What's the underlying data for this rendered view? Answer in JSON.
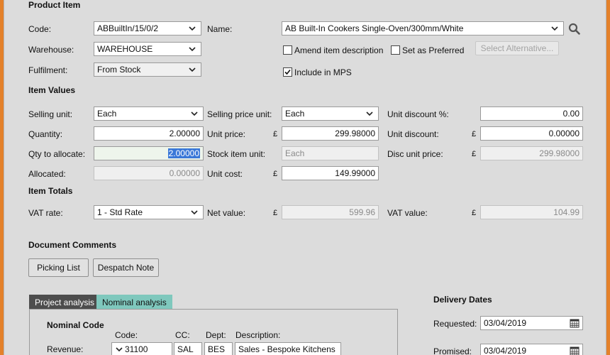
{
  "sections": {
    "product_item": "Product Item",
    "item_values": "Item Values",
    "item_totals": "Item Totals",
    "document_comments": "Document Comments",
    "delivery_dates": "Delivery Dates"
  },
  "product": {
    "code_label": "Code:",
    "code_value": "ABBuiltIn/15/0/2",
    "name_label": "Name:",
    "name_value": "AB Built-In Cookers Single-Oven/300mm/White",
    "warehouse_label": "Warehouse:",
    "warehouse_value": "WAREHOUSE",
    "fulfilment_label": "Fulfilment:",
    "fulfilment_value": "From Stock",
    "amend_label": "Amend item description",
    "amend_checked": false,
    "preferred_label": "Set as Preferred",
    "preferred_checked": false,
    "select_alt_label": "Select Alternative...",
    "mps_label": "Include in MPS",
    "mps_checked": true
  },
  "values": {
    "selling_unit_label": "Selling unit:",
    "selling_unit_value": "Each",
    "selling_price_unit_label": "Selling price unit:",
    "selling_price_unit_value": "Each",
    "unit_discount_pct_label": "Unit discount %:",
    "unit_discount_pct_value": "0.00",
    "quantity_label": "Quantity:",
    "quantity_value": "2.00000",
    "unit_price_label": "Unit price:",
    "unit_price_value": "299.98000",
    "unit_discount_label": "Unit discount:",
    "unit_discount_value": "0.00000",
    "qty_allocate_label": "Qty to allocate:",
    "qty_allocate_value": "2.00000",
    "stock_item_unit_label": "Stock item unit:",
    "stock_item_unit_value": "Each",
    "disc_unit_price_label": "Disc unit price:",
    "disc_unit_price_value": "299.98000",
    "allocated_label": "Allocated:",
    "allocated_value": "0.00000",
    "unit_cost_label": "Unit cost:",
    "unit_cost_value": "149.99000",
    "currency": "£"
  },
  "totals": {
    "vat_rate_label": "VAT rate:",
    "vat_rate_value": "1 - Std Rate",
    "net_value_label": "Net value:",
    "net_value_value": "599.96",
    "vat_value_label": "VAT value:",
    "vat_value_value": "104.99"
  },
  "comments": {
    "picking_list_label": "Picking List",
    "despatch_note_label": "Despatch Note"
  },
  "analysis": {
    "tab_project": "Project analysis",
    "tab_nominal": "Nominal analysis",
    "nominal_code_title": "Nominal Code",
    "col_code": "Code:",
    "col_cc": "CC:",
    "col_dept": "Dept:",
    "col_description": "Description:",
    "revenue_label": "Revenue:",
    "revenue_code": "31100",
    "revenue_cc": "SAL",
    "revenue_dept": "BES",
    "revenue_description": "Sales - Bespoke Kitchens"
  },
  "delivery": {
    "requested_label": "Requested:",
    "requested_value": "03/04/2019",
    "promised_label": "Promised:",
    "promised_value": "03/04/2019"
  },
  "colors": {
    "frame": "#e4812a",
    "panel": "#dcdcdc",
    "tab_active": "#7fc8bd",
    "tab_dark": "#4d4d4d",
    "selection": "#3a78d8"
  }
}
